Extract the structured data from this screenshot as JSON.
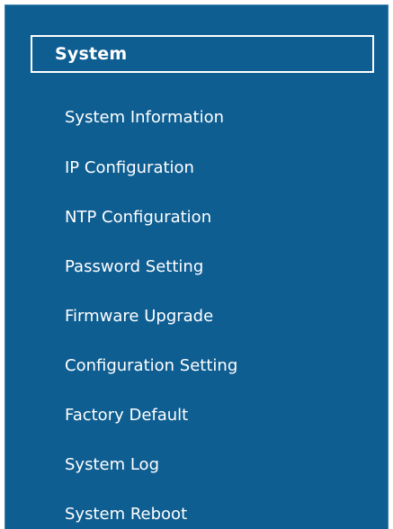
{
  "sidebar": {
    "header": "System",
    "items": [
      {
        "label": "System Information"
      },
      {
        "label": "IP Configuration"
      },
      {
        "label": "NTP Configuration"
      },
      {
        "label": "Password Setting"
      },
      {
        "label": "Firmware Upgrade"
      },
      {
        "label": "Configuration Setting"
      },
      {
        "label": "Factory Default"
      },
      {
        "label": "System Log"
      },
      {
        "label": "System Reboot"
      }
    ]
  },
  "colors": {
    "sidebar_background": "#0f5e92",
    "text": "#ffffff",
    "header_border": "#ffffff"
  }
}
